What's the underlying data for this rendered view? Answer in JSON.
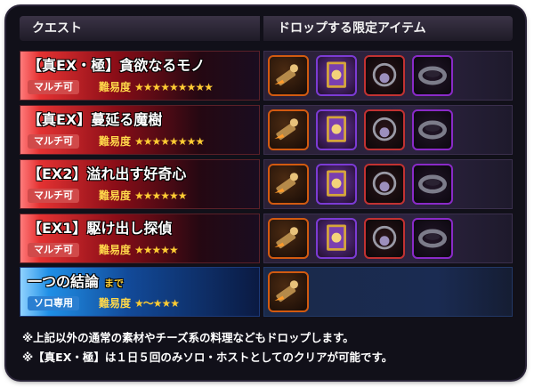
{
  "headers": {
    "quest": "クエスト",
    "items": "ドロップする限定アイテム"
  },
  "rows": [
    {
      "title": "【真EX・極】貪欲なるモノ",
      "badge": "マルチ可",
      "difficulty_label": "難易度",
      "stars": "★★★★★★★★★",
      "items": [
        "item-a",
        "item-b",
        "item-c",
        "item-d"
      ]
    },
    {
      "title": "【真EX】蔓延る魔樹",
      "badge": "マルチ可",
      "difficulty_label": "難易度",
      "stars": "★★★★★★★★",
      "items": [
        "item-a",
        "item-b",
        "item-c",
        "item-d"
      ]
    },
    {
      "title": "【EX2】溢れ出す好奇心",
      "badge": "マルチ可",
      "difficulty_label": "難易度",
      "stars": "★★★★★★",
      "items": [
        "item-a",
        "item-b",
        "item-c",
        "item-d"
      ]
    },
    {
      "title": "【EX1】駆け出し探偵",
      "badge": "マルチ可",
      "difficulty_label": "難易度",
      "stars": "★★★★★",
      "items": [
        "item-a",
        "item-b",
        "item-c",
        "item-d"
      ]
    },
    {
      "title": "一つの結論",
      "title_suffix": "まで",
      "badge": "ソロ専用",
      "difficulty_label": "難易度",
      "stars": "★～★★★",
      "items": [
        "item-a"
      ]
    }
  ],
  "notes": [
    "※上記以外の通常の素材やチーズ系の料理などもドロップします。",
    "※【真EX・極】は１日５回のみソロ・ホストとしてのクリアが可能です。"
  ]
}
